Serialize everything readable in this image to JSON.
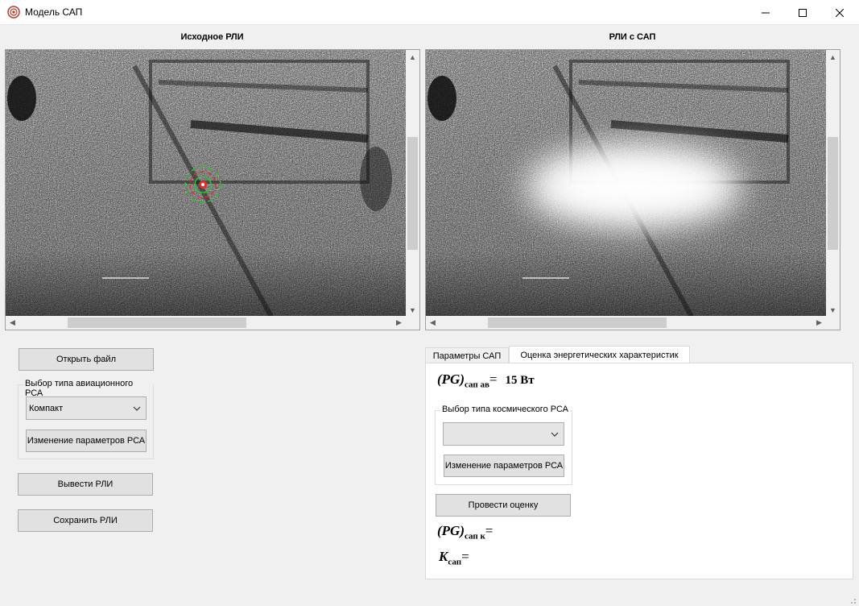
{
  "window": {
    "title": "Модель САП"
  },
  "views": {
    "left_title": "Исходное РЛИ",
    "right_title": "РЛИ с САП"
  },
  "left_panel": {
    "open_file": "Открыть файл",
    "aviation_group_label": "Выбор типа авиационного РСА",
    "aviation_selected": "Компакт",
    "change_params": "Изменение параметров РСА",
    "output_image": "Вывести РЛИ",
    "save_image": "Сохранить РЛИ"
  },
  "tabs": {
    "items": [
      {
        "label": "Параметры САП"
      },
      {
        "label": "Оценка энергетических характеристик"
      }
    ]
  },
  "energy": {
    "pg_av_symbol": "(PG)",
    "pg_av_sub": "сап ав",
    "equals": "=",
    "pg_av_value": "15 Вт",
    "space_group_label": "Выбор типа космического РСА",
    "space_selected": "",
    "change_params": "Изменение параметров РСА",
    "run_estimate": "Провести оценку",
    "pg_k_symbol": "(PG)",
    "pg_k_sub": "сап к",
    "k_symbol": "K",
    "k_sub": "сап"
  },
  "colors": {
    "target_green": "#2fbf2f",
    "target_red": "#e0302a"
  }
}
